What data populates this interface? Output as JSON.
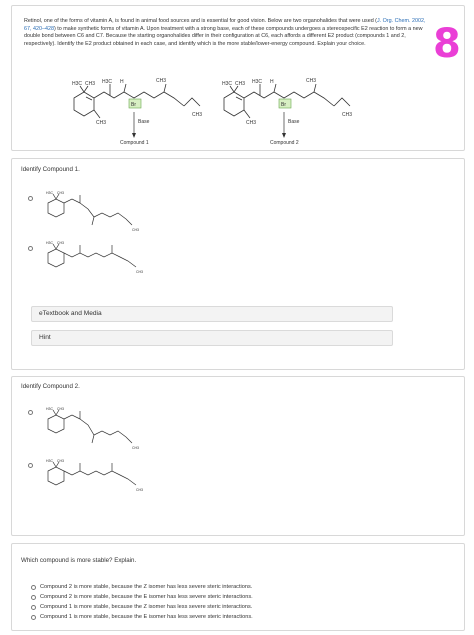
{
  "intro": {
    "text_before_link": "Retinol, one of the forms of vitamin A, is found in animal food sources and is essential for good vision. Below are two organohalides that were used (",
    "citation": "J. Org. Chem. 2002, 67, 420–428",
    "text_after_link": ") to make synthetic forms of vitamin A. Upon treatment with a strong base, each of these compounds undergoes a stereospecific E2 reaction to form a new double bond between C6 and C7. Because the starting organohalides differ in their configuration at C6, each affords a different E2 product (compounds 1 and 2, respectively). Identify the E2 product obtained in each case, and identify which is the more stable/lower-energy compound. Explain your choice."
  },
  "badge": "8",
  "scheme": {
    "left": {
      "reagent": "Base",
      "product": "Compound 1",
      "leaving_group": "Br"
    },
    "right": {
      "reagent": "Base",
      "product": "Compound 2",
      "leaving_group": "Br"
    },
    "labels": {
      "h3c": "H3C",
      "ch3": "CH3",
      "h": "H",
      "och3": "CH3"
    }
  },
  "question1": {
    "title": "Identify Compound 1.",
    "etextbook_label": "eTextbook and Media",
    "hint_label": "Hint"
  },
  "question2": {
    "title": "Identify Compound 2."
  },
  "question3": {
    "title": "Which compound is more stable? Explain.",
    "options": [
      "Compound 2 is more stable, because the Z isomer has less severe steric interactions.",
      "Compound 2 is more stable, because the E isomer has less severe steric interactions.",
      "Compound 1 is more stable, because the Z isomer has less severe steric interactions.",
      "Compound 1 is more stable, because the E isomer has less severe steric interactions."
    ]
  }
}
